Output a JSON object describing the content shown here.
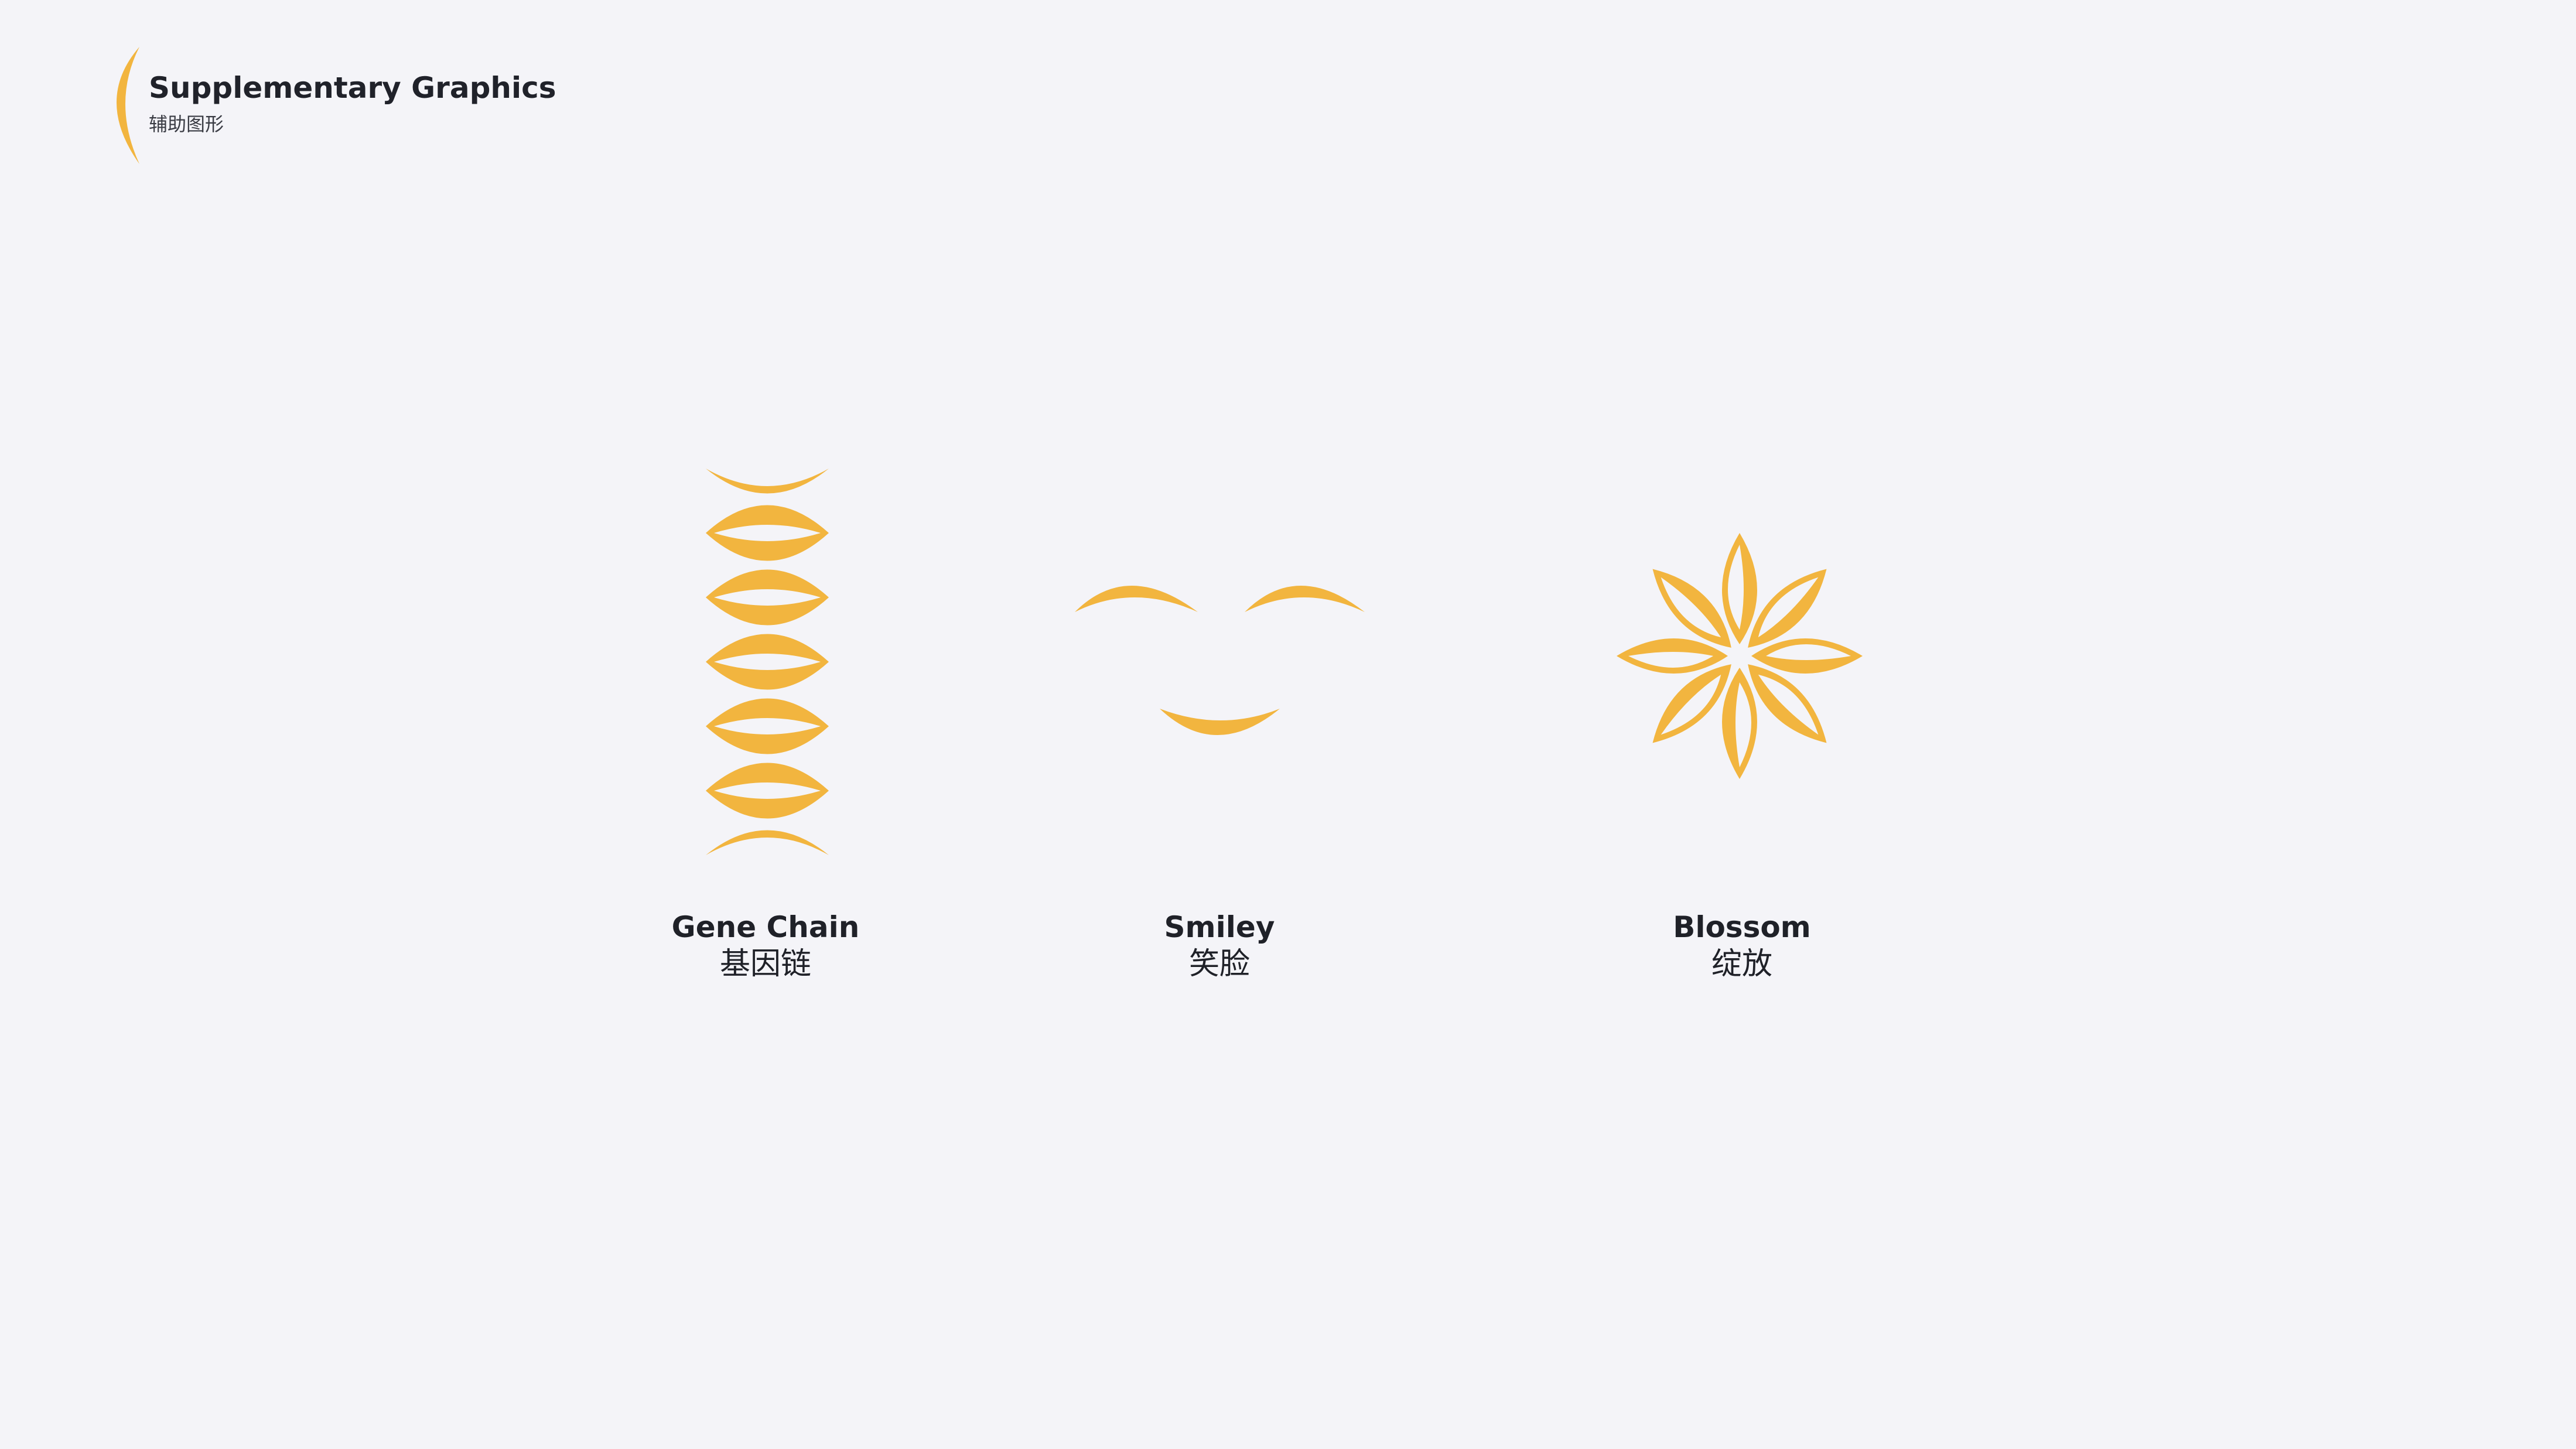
{
  "header": {
    "title": "Supplementary Graphics",
    "subtitle": "辅助图形",
    "mark_icon": "crescent-mark-icon"
  },
  "graphics": [
    {
      "id": "gene-chain",
      "label_en": "Gene Chain",
      "label_cn": "基因链",
      "icon": "gene-chain-icon"
    },
    {
      "id": "smiley",
      "label_en": "Smiley",
      "label_cn": "笑脸",
      "icon": "smiley-icon"
    },
    {
      "id": "blossom",
      "label_en": "Blossom",
      "label_cn": "绽放",
      "icon": "blossom-icon"
    }
  ],
  "colors": {
    "background": "#f4f4f8",
    "accent": "#f2b53f",
    "text": "#1f2128"
  }
}
